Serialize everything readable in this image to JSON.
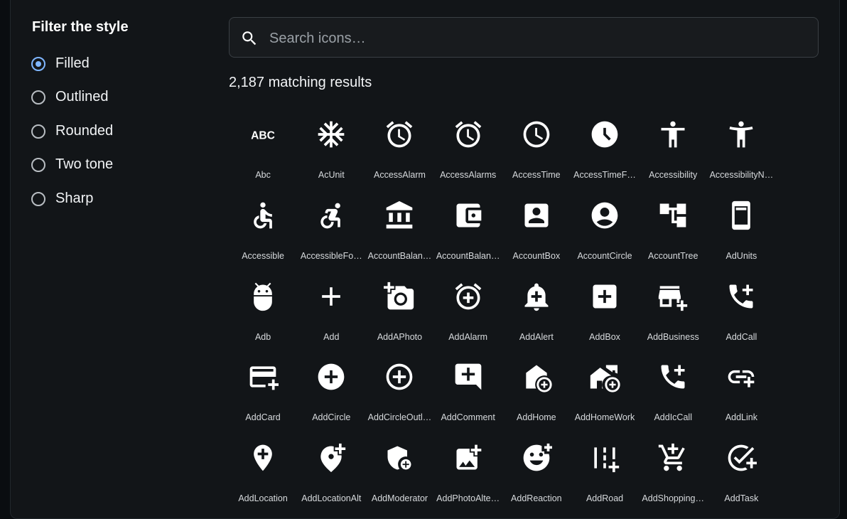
{
  "sidebar": {
    "title": "Filter the style",
    "options": [
      {
        "label": "Filled",
        "selected": true
      },
      {
        "label": "Outlined",
        "selected": false
      },
      {
        "label": "Rounded",
        "selected": false
      },
      {
        "label": "Two tone",
        "selected": false
      },
      {
        "label": "Sharp",
        "selected": false
      }
    ]
  },
  "search": {
    "placeholder": "Search icons…",
    "value": "",
    "icon": "search-icon"
  },
  "results": {
    "text": "2,187 matching results"
  },
  "colors": {
    "accent": "#7fb6ff",
    "background": "#121518",
    "text": "#ffffff"
  },
  "icons": [
    {
      "label": "Abc",
      "icon": "abc-icon"
    },
    {
      "label": "AcUnit",
      "icon": "ac-unit-icon"
    },
    {
      "label": "AccessAlarm",
      "icon": "access-alarm-icon"
    },
    {
      "label": "AccessAlarms",
      "icon": "access-alarms-icon"
    },
    {
      "label": "AccessTime",
      "icon": "access-time-icon"
    },
    {
      "label": "AccessTimeF…",
      "icon": "access-time-filled-icon"
    },
    {
      "label": "Accessibility",
      "icon": "accessibility-icon"
    },
    {
      "label": "AccessibilityN…",
      "icon": "accessibility-new-icon"
    },
    {
      "label": "Accessible",
      "icon": "accessible-icon"
    },
    {
      "label": "AccessibleFo…",
      "icon": "accessible-forward-icon"
    },
    {
      "label": "AccountBalan…",
      "icon": "account-balance-icon"
    },
    {
      "label": "AccountBalan…",
      "icon": "account-balance-wallet-icon"
    },
    {
      "label": "AccountBox",
      "icon": "account-box-icon"
    },
    {
      "label": "AccountCircle",
      "icon": "account-circle-icon"
    },
    {
      "label": "AccountTree",
      "icon": "account-tree-icon"
    },
    {
      "label": "AdUnits",
      "icon": "ad-units-icon"
    },
    {
      "label": "Adb",
      "icon": "adb-icon"
    },
    {
      "label": "Add",
      "icon": "add-icon"
    },
    {
      "label": "AddAPhoto",
      "icon": "add-a-photo-icon"
    },
    {
      "label": "AddAlarm",
      "icon": "add-alarm-icon"
    },
    {
      "label": "AddAlert",
      "icon": "add-alert-icon"
    },
    {
      "label": "AddBox",
      "icon": "add-box-icon"
    },
    {
      "label": "AddBusiness",
      "icon": "add-business-icon"
    },
    {
      "label": "AddCall",
      "icon": "add-call-icon"
    },
    {
      "label": "AddCard",
      "icon": "add-card-icon"
    },
    {
      "label": "AddCircle",
      "icon": "add-circle-icon"
    },
    {
      "label": "AddCircleOutl…",
      "icon": "add-circle-outline-icon"
    },
    {
      "label": "AddComment",
      "icon": "add-comment-icon"
    },
    {
      "label": "AddHome",
      "icon": "add-home-icon"
    },
    {
      "label": "AddHomeWork",
      "icon": "add-home-work-icon"
    },
    {
      "label": "AddIcCall",
      "icon": "add-ic-call-icon"
    },
    {
      "label": "AddLink",
      "icon": "add-link-icon"
    },
    {
      "label": "AddLocation",
      "icon": "add-location-icon"
    },
    {
      "label": "AddLocationAlt",
      "icon": "add-location-alt-icon"
    },
    {
      "label": "AddModerator",
      "icon": "add-moderator-icon"
    },
    {
      "label": "AddPhotoAlte…",
      "icon": "add-photo-alternate-icon"
    },
    {
      "label": "AddReaction",
      "icon": "add-reaction-icon"
    },
    {
      "label": "AddRoad",
      "icon": "add-road-icon"
    },
    {
      "label": "AddShopping…",
      "icon": "add-shopping-cart-icon"
    },
    {
      "label": "AddTask",
      "icon": "add-task-icon"
    }
  ]
}
